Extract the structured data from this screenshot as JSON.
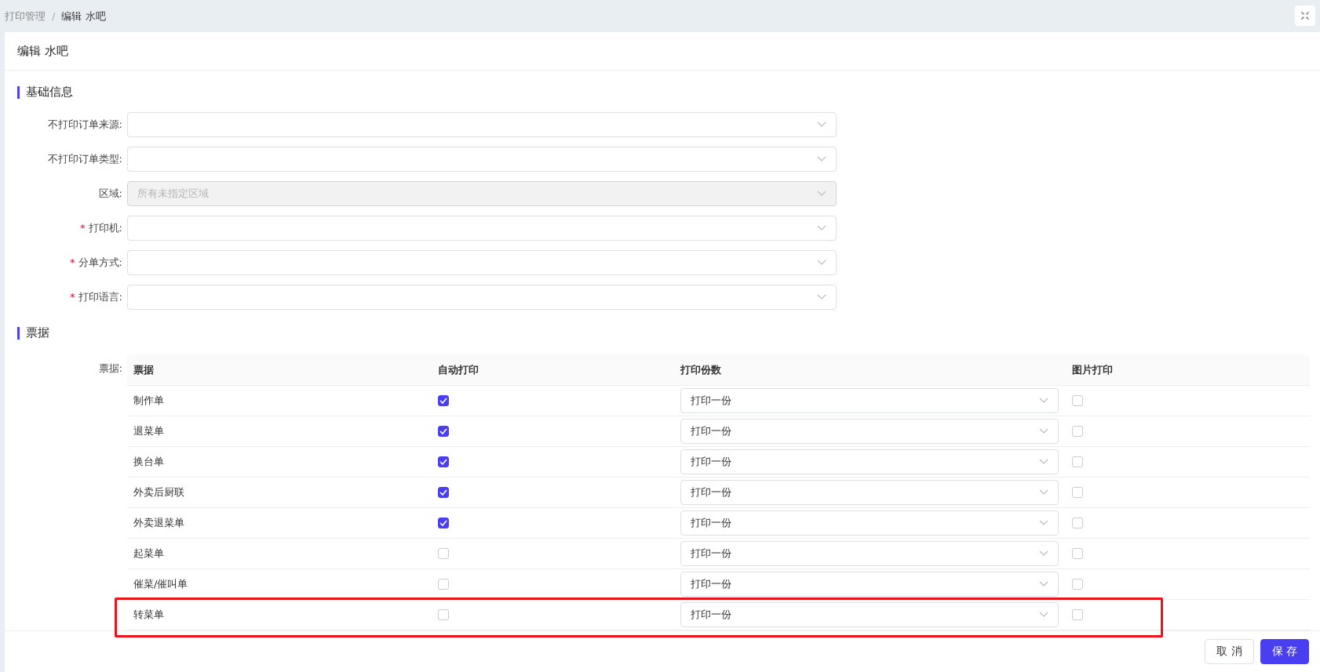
{
  "breadcrumb": [
    {
      "label": "打印管理",
      "current": false
    },
    {
      "label": "编辑 水吧",
      "current": true
    }
  ],
  "breadcrumb_separator": "/",
  "page_title": "编辑 水吧",
  "basic_section": {
    "title": "基础信息",
    "fields": [
      {
        "label": "不打印订单来源:",
        "disabled": false
      },
      {
        "label": "不打印订单类型:",
        "disabled": false
      },
      {
        "label": "区域:",
        "disabled": true,
        "placeholder": "所有未指定区域"
      },
      {
        "required_mark": "*",
        "label": "打印机:",
        "disabled": false
      },
      {
        "required_mark": "*",
        "label": "分单方式:",
        "disabled": false
      },
      {
        "required_mark": "*",
        "label": "打印语言:",
        "disabled": false
      }
    ]
  },
  "ticket_section": {
    "title": "票据",
    "field_label": "票据:",
    "table": {
      "columns": [
        "票据",
        "自动打印",
        "打印份数",
        "图片打印"
      ],
      "rows": [
        {
          "name": "制作单",
          "auto_print": true,
          "copies": "打印一份",
          "image_print": false,
          "highlighted": false
        },
        {
          "name": "退菜单",
          "auto_print": true,
          "copies": "打印一份",
          "image_print": false,
          "highlighted": false
        },
        {
          "name": "换台单",
          "auto_print": true,
          "copies": "打印一份",
          "image_print": false,
          "highlighted": false
        },
        {
          "name": "外卖后厨联",
          "auto_print": true,
          "copies": "打印一份",
          "image_print": false,
          "highlighted": false
        },
        {
          "name": "外卖退菜单",
          "auto_print": true,
          "copies": "打印一份",
          "image_print": false,
          "highlighted": false
        },
        {
          "name": "起菜单",
          "auto_print": false,
          "copies": "打印一份",
          "image_print": false,
          "highlighted": false
        },
        {
          "name": "催菜/催叫单",
          "auto_print": false,
          "copies": "打印一份",
          "image_print": false,
          "highlighted": false
        },
        {
          "name": "转菜单",
          "auto_print": false,
          "copies": "打印一份",
          "image_print": false,
          "highlighted": true
        }
      ]
    }
  },
  "buttons": {
    "cancel": "取 消",
    "save": "保 存"
  }
}
